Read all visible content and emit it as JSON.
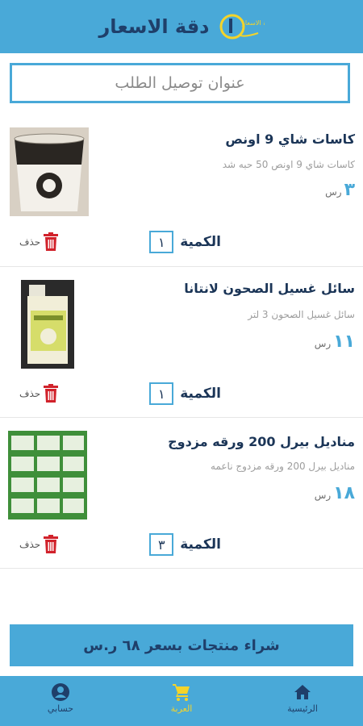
{
  "header": {
    "title": "دقة الاسعار",
    "logo_text": "دقة الاسعار"
  },
  "address": {
    "placeholder": "عنوان توصيل الطلب"
  },
  "items": [
    {
      "name": "كاسات شاي 9 اونص",
      "desc": "كاسات شاي 9 اونص 50 حبه شد",
      "price": "٣",
      "currency": "رس",
      "qty_label": "الكمية",
      "qty": "١",
      "delete_label": "حذف"
    },
    {
      "name": "سائل غسيل الصحون لانتانا",
      "desc": "سائل غسيل الصحون 3 لتر",
      "price": "١١",
      "currency": "رس",
      "qty_label": "الكمية",
      "qty": "١",
      "delete_label": "حذف"
    },
    {
      "name": "مناديل بيرل 200 ورقه مزدوج",
      "desc": "مناديل بيرل 200 ورقه مزدوج ناعمه",
      "price": "١٨",
      "currency": "رس",
      "qty_label": "الكمية",
      "qty": "٣",
      "delete_label": "حذف"
    }
  ],
  "buy_button": "شراء منتجات بسعر ٦٨ ر.س",
  "nav": {
    "home": "الرئيسية",
    "cart": "العربة",
    "account": "حسابي"
  },
  "colors": {
    "primary": "#49a9d8",
    "accent": "#f4d42a",
    "delete": "#d1222b",
    "title_text": "#1f3f6a"
  }
}
